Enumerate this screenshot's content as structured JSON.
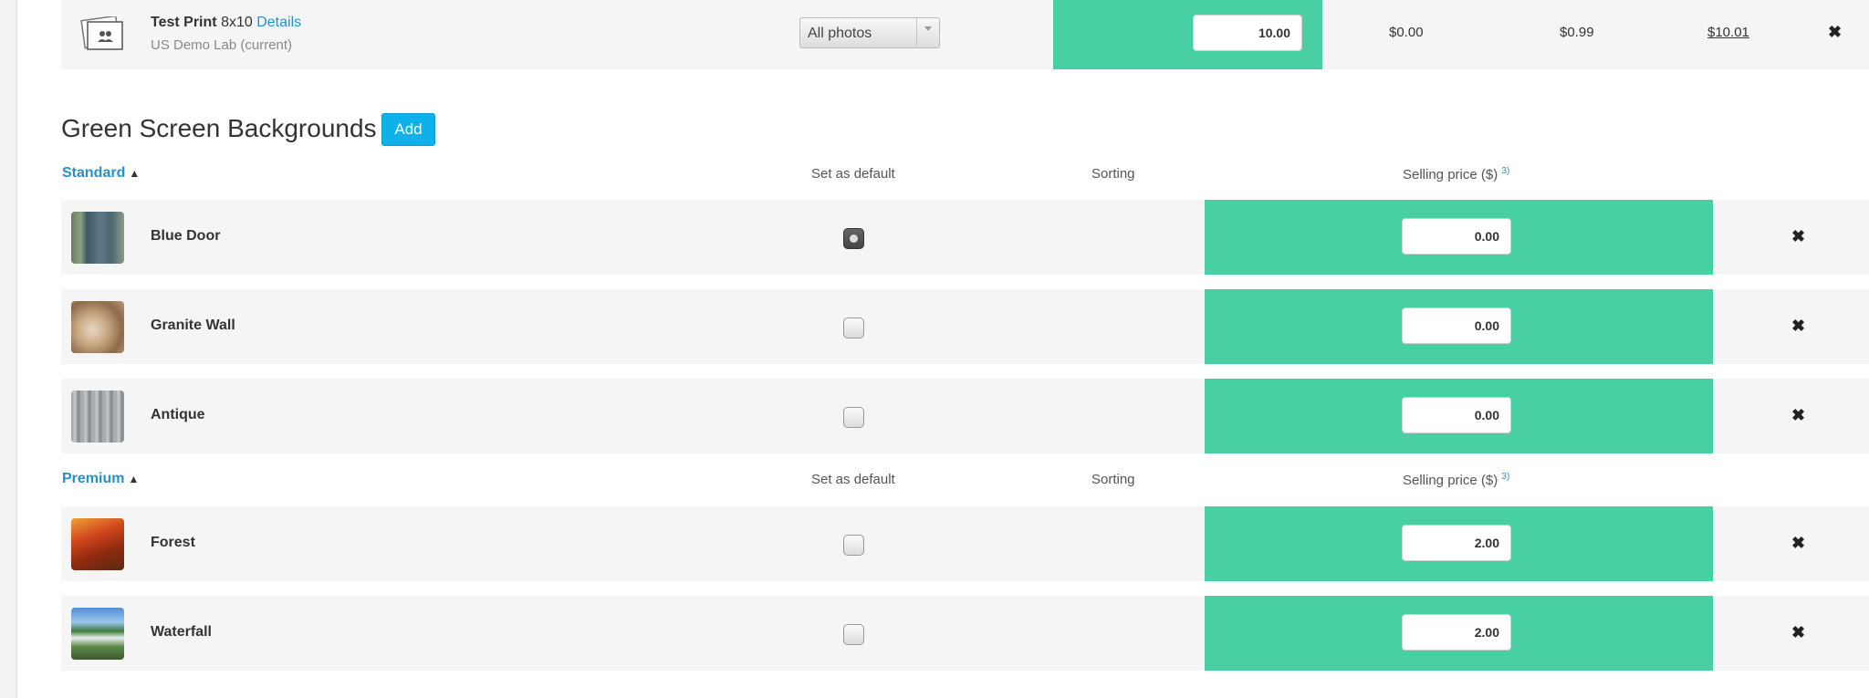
{
  "print_row": {
    "title": "Test Print",
    "size": "8x10",
    "details_link": "Details",
    "lab": "US Demo Lab (current)",
    "photos_select": "All photos",
    "price_value": "10.00",
    "price_1": "$0.00",
    "price_2": "$0.99",
    "price_3": "$10.01",
    "icon": "photos-icon"
  },
  "section": {
    "title": "Green Screen Backgrounds",
    "add_label": "Add"
  },
  "columns": {
    "set_default": "Set as default",
    "sorting": "Sorting",
    "selling_price": "Selling price ($)",
    "footnote": "3)"
  },
  "groups": {
    "standard": {
      "label": "Standard",
      "items": [
        {
          "name": "Blue Door",
          "price": "0.00",
          "default": true
        },
        {
          "name": "Granite Wall",
          "price": "0.00",
          "default": false
        },
        {
          "name": "Antique",
          "price": "0.00",
          "default": false
        }
      ]
    },
    "premium": {
      "label": "Premium",
      "items": [
        {
          "name": "Forest",
          "price": "2.00",
          "default": false
        },
        {
          "name": "Waterfall",
          "price": "2.00",
          "default": false
        }
      ]
    }
  },
  "colors": {
    "accent_green": "#48d0a4",
    "link_blue": "#2a8fc7",
    "button_blue": "#0fb1ea",
    "row_bg": "#f5f5f5"
  },
  "icons": {
    "delete": "delete-icon",
    "collapse": "chevron-up-icon"
  }
}
